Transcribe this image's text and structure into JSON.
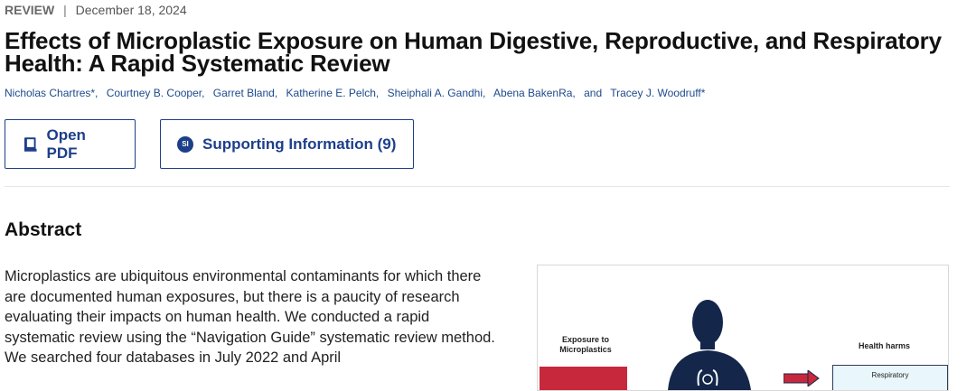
{
  "article": {
    "type": "REVIEW",
    "separator": "|",
    "date": "December 18, 2024",
    "title": "Effects of Microplastic Exposure on Human Digestive, Reproductive, and Respiratory Health: A Rapid Systematic Review",
    "authors": [
      "Nicholas Chartres*,",
      "Courtney B. Cooper,",
      "Garret Bland,",
      "Katherine E. Pelch,",
      "Sheiphali A. Gandhi,",
      "Abena BakenRa,",
      "and",
      "Tracey J. Woodruff*"
    ]
  },
  "actions": {
    "open_pdf_label": "Open PDF",
    "supporting_info_label": "Supporting Information (9)",
    "si_badge": "SI"
  },
  "abstract": {
    "heading": "Abstract",
    "text": "Microplastics are ubiquitous environmental contaminants for which there are documented human exposures, but there is a paucity of research evaluating their impacts on human health. We conducted a rapid systematic review using the “Navigation Guide” systematic review method. We searched four databases in July 2022 and April"
  },
  "toc_graphic": {
    "exposure_label": "Exposure to Microplastics",
    "harms_label": "Health harms",
    "box_label": "Respiratory",
    "colors": {
      "red": "#c8283c",
      "navy": "#14274a"
    }
  }
}
